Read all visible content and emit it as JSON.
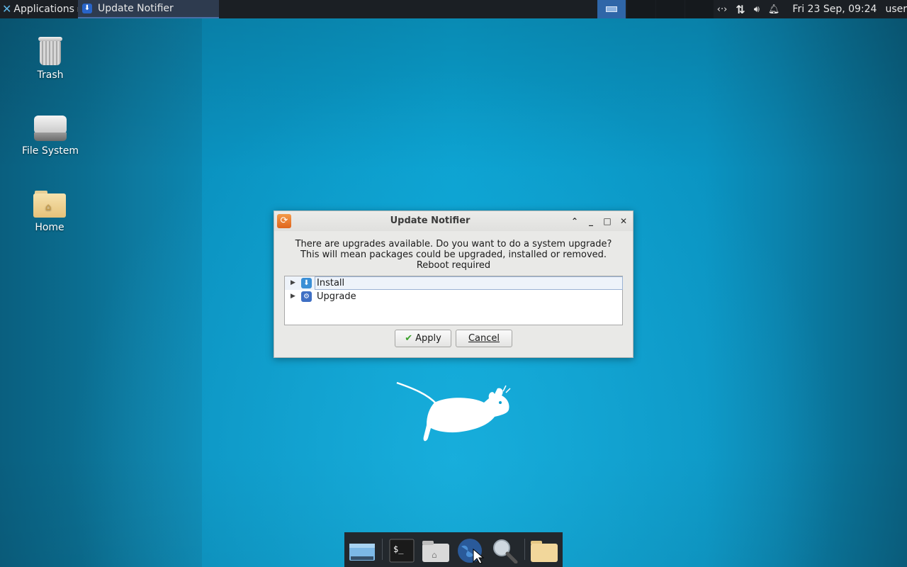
{
  "top_panel": {
    "applications_label": "Applications",
    "task_title": "Update Notifier",
    "clock": "Fri 23 Sep, 09:24",
    "user": "user",
    "tray_icons": [
      "network-icon",
      "transfer-arrows-icon",
      "volume-icon",
      "bell-icon"
    ]
  },
  "desktop": {
    "icons": [
      {
        "label": "Trash",
        "icon": "trash-icon"
      },
      {
        "label": "File System",
        "icon": "drive-icon"
      },
      {
        "label": "Home",
        "icon": "home-folder-icon"
      }
    ]
  },
  "dialog": {
    "title": "Update Notifier",
    "message_lines": [
      "There are upgrades available. Do you want to do a system upgrade?",
      "This will mean packages could be upgraded, installed or removed.",
      "Reboot required"
    ],
    "tree_items": [
      {
        "label": "Install",
        "icon": "download-icon",
        "selected": true
      },
      {
        "label": "Upgrade",
        "icon": "gear-icon",
        "selected": false
      }
    ],
    "buttons": {
      "apply": "Apply",
      "cancel": "Cancel"
    }
  },
  "dock": {
    "items": [
      "show-desktop-icon",
      "terminal-icon",
      "file-manager-icon",
      "web-browser-icon",
      "search-icon",
      "folder-icon"
    ]
  },
  "colors": {
    "panel_bg": "#1b1f24",
    "desktop_accent": "#0aa0cf",
    "selection": "#eef3fa"
  }
}
